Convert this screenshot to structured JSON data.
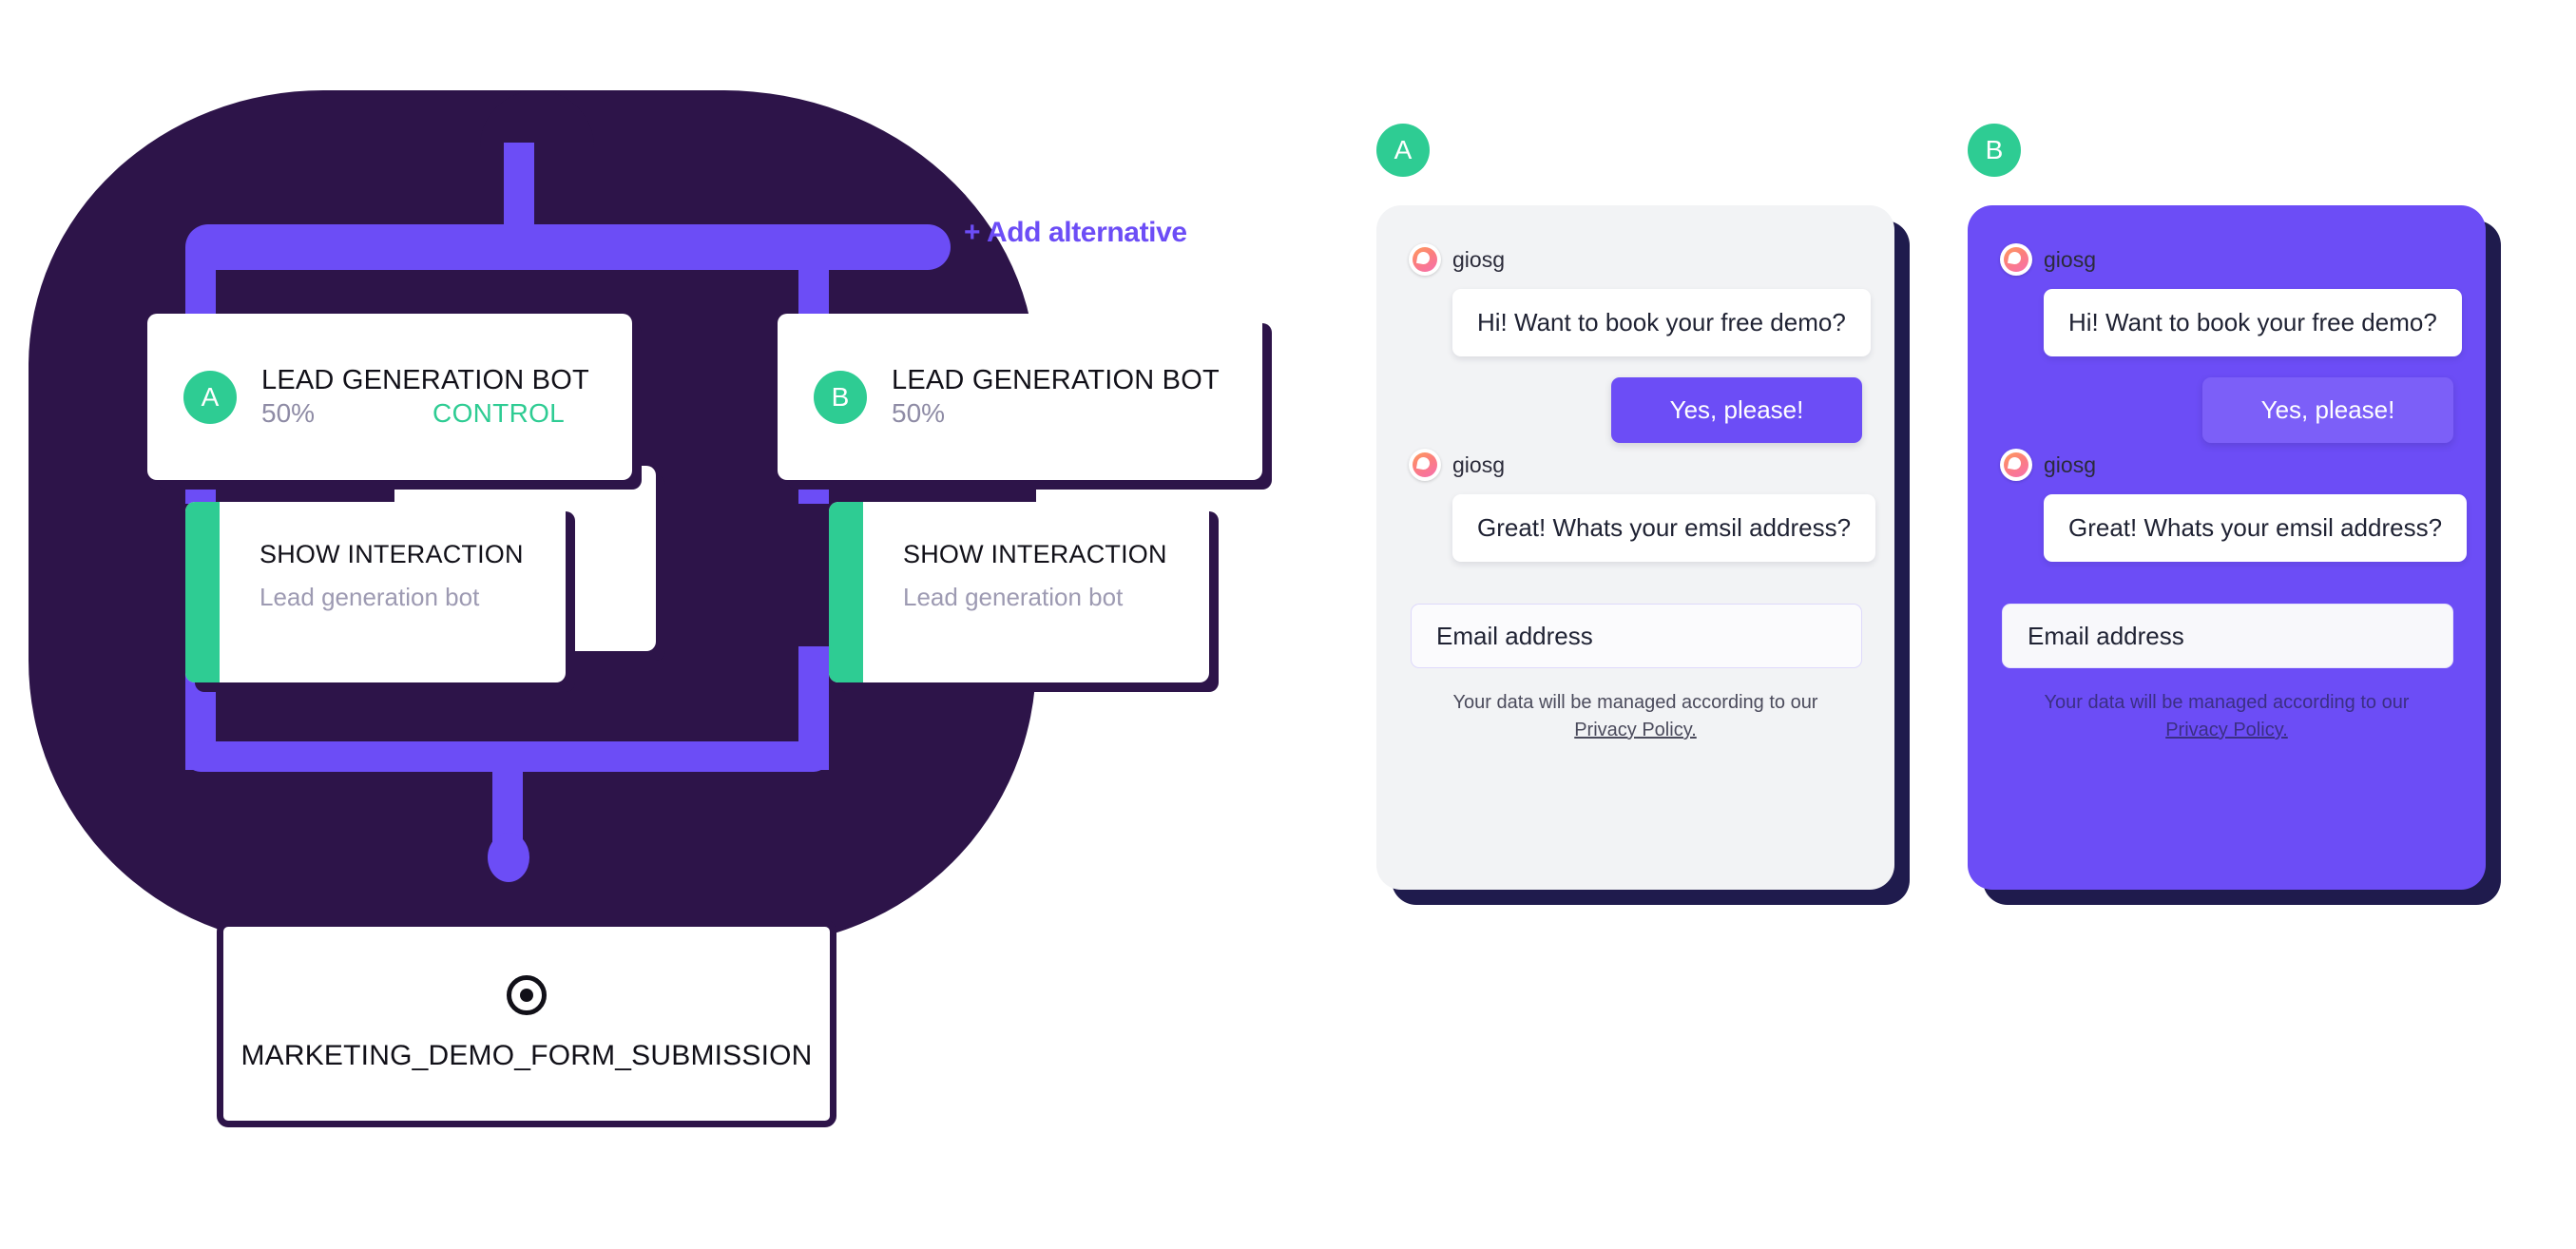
{
  "flow": {
    "add_alternative_label": "+ Add alternative",
    "variants": [
      {
        "badge": "A",
        "title": "LEAD GENERATION BOT",
        "percent": "50%",
        "control_label": "CONTROL",
        "action_title": "SHOW INTERACTION",
        "action_sub": "Lead generation bot"
      },
      {
        "badge": "B",
        "title": "LEAD GENERATION BOT",
        "percent": "50%",
        "control_label": "",
        "action_title": "SHOW INTERACTION",
        "action_sub": "Lead generation bot"
      }
    ],
    "goal": {
      "icon": "target-icon",
      "label": "MARKETING_DEMO_FORM_SUBMISSION"
    },
    "colors": {
      "blob": "#2d1449",
      "connector": "#6c4df6",
      "badge_green": "#2ecc93",
      "control_green": "#2ecc93",
      "accent_purple": "#6c4df6"
    }
  },
  "previews": [
    {
      "badge": "A",
      "theme": "light",
      "bot_name_1": "giosg",
      "message_1": "Hi! Want to book your free demo?",
      "reply_label": "Yes, please!",
      "bot_name_2": "giosg",
      "message_2": "Great! Whats your emsil address?",
      "field_placeholder": "Email address",
      "legal_text": "Your data will be managed according to our",
      "legal_link": "Privacy Policy.",
      "bg": "#f2f3f5"
    },
    {
      "badge": "B",
      "theme": "dark",
      "bot_name_1": "giosg",
      "message_1": "Hi! Want to book your free demo?",
      "reply_label": "Yes, please!",
      "bot_name_2": "giosg",
      "message_2": "Great! Whats your emsil address?",
      "field_placeholder": "Email address",
      "legal_text": "Your data will be managed according to our",
      "legal_link": "Privacy Policy.",
      "bg": "#6c4df6"
    }
  ]
}
